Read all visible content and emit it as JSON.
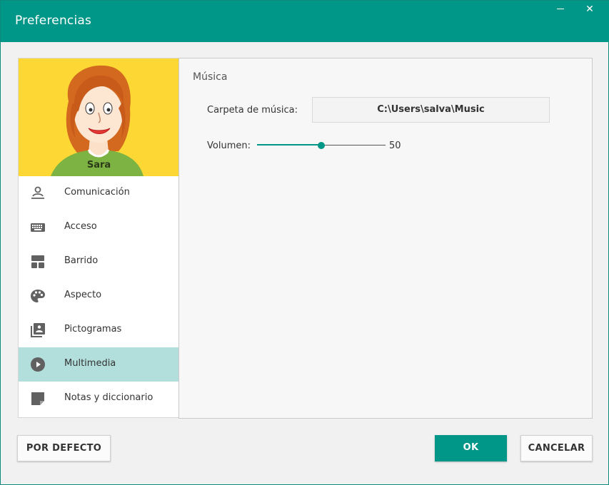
{
  "window": {
    "title": "Preferencias",
    "close_glyph": "✕"
  },
  "profile": {
    "name": "Sara"
  },
  "sidebar": {
    "items": [
      {
        "label": "Comunicación",
        "icon": "person-speaking-icon"
      },
      {
        "label": "Acceso",
        "icon": "keyboard-icon"
      },
      {
        "label": "Barrido",
        "icon": "scan-grid-icon"
      },
      {
        "label": "Aspecto",
        "icon": "palette-icon"
      },
      {
        "label": "Pictogramas",
        "icon": "photo-library-icon"
      },
      {
        "label": "Multimedia",
        "icon": "play-circle-icon",
        "active": true
      },
      {
        "label": "Notas y diccionario",
        "icon": "sticky-note-icon"
      }
    ]
  },
  "main": {
    "section_title": "Música",
    "music_folder_label": "Carpeta de música:",
    "music_folder_value": "C:\\Users\\salva\\Music",
    "volume_label": "Volumen:",
    "volume_value": "50",
    "volume_fraction": 0.5
  },
  "buttons": {
    "default_label": "POR DEFECTO",
    "ok_label": "OK",
    "cancel_label": "CANCELAR"
  },
  "colors": {
    "accent": "#009688",
    "active_item": "#b2dfdb",
    "avatar_bg": "#fdd835",
    "icon": "#616161"
  }
}
